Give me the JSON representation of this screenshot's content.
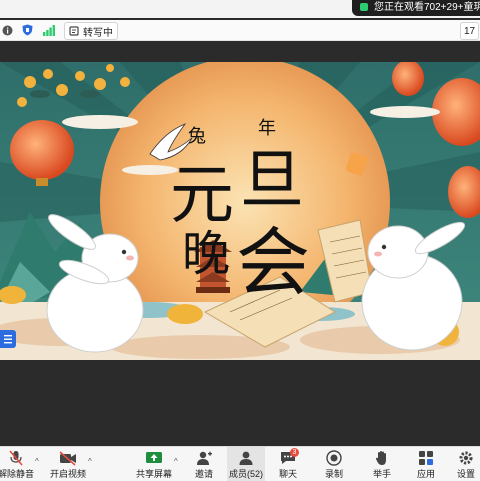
{
  "notification": {
    "text": "您正在观看702+29+童玥"
  },
  "status_bar": {
    "transcription_label": "转写中",
    "right_value": "17"
  },
  "slide": {
    "small_text_1": "兔",
    "small_text_2": "年",
    "big_1": "元",
    "big_2": "旦",
    "big_3": "晚",
    "big_4": "会"
  },
  "toolbar": {
    "unmute": "解除静音",
    "video": "开启视频",
    "share": "共享屏幕",
    "invite": "邀请",
    "members": "成员(52)",
    "chat": "聊天",
    "chat_badge": "3",
    "record": "录制",
    "raise_hand": "举手",
    "apps": "应用",
    "settings": "设置"
  }
}
